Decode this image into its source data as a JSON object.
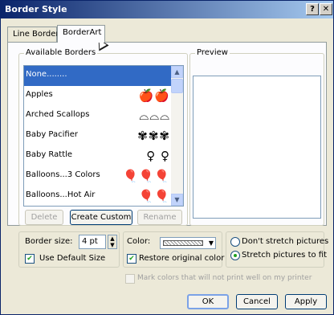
{
  "window": {
    "title": "Border Style",
    "help_glyph": "?",
    "close_glyph": "✕"
  },
  "tabs": [
    {
      "label": "Line Border",
      "active": false
    },
    {
      "label": "BorderArt",
      "active": true
    }
  ],
  "available_borders": {
    "group_label": "Available Borders",
    "items": [
      {
        "label": "None........",
        "art": "",
        "selected": true
      },
      {
        "label": "Apples",
        "art": "🍎🍎",
        "selected": false
      },
      {
        "label": "Arched Scallops",
        "art": "⌓⌓⌓",
        "selected": false
      },
      {
        "label": "Baby Pacifier",
        "art": "✾✾✾",
        "selected": false
      },
      {
        "label": "Baby Rattle",
        "art": "♀ ♀",
        "selected": false
      },
      {
        "label": "Balloons...3 Colors",
        "art": "🎈🎈🎈",
        "selected": false
      },
      {
        "label": "Balloons...Hot Air",
        "art": "🎈🎈",
        "selected": false
      }
    ],
    "delete_label": "Delete",
    "create_custom_label": "Create Custom",
    "rename_label": "Rename"
  },
  "preview": {
    "group_label": "Preview"
  },
  "border_size": {
    "label": "Border size:",
    "value": "4 pt",
    "use_default_label": "Use Default Size",
    "use_default_checked": true
  },
  "color": {
    "label": "Color:",
    "restore_label": "Restore original color",
    "restore_checked": true
  },
  "stretch": {
    "dont_stretch_label": "Don't stretch pictures",
    "stretch_label": "Stretch pictures to fit",
    "selected": "stretch"
  },
  "mark_colors_label": "Mark colors that will not print well on my printer",
  "buttons": {
    "ok": "OK",
    "cancel": "Cancel",
    "apply": "Apply"
  },
  "colors": {
    "titlebar_start": "#0a246a",
    "titlebar_end": "#a6caf0",
    "selection": "#316ac5",
    "check_green": "#21a121"
  }
}
